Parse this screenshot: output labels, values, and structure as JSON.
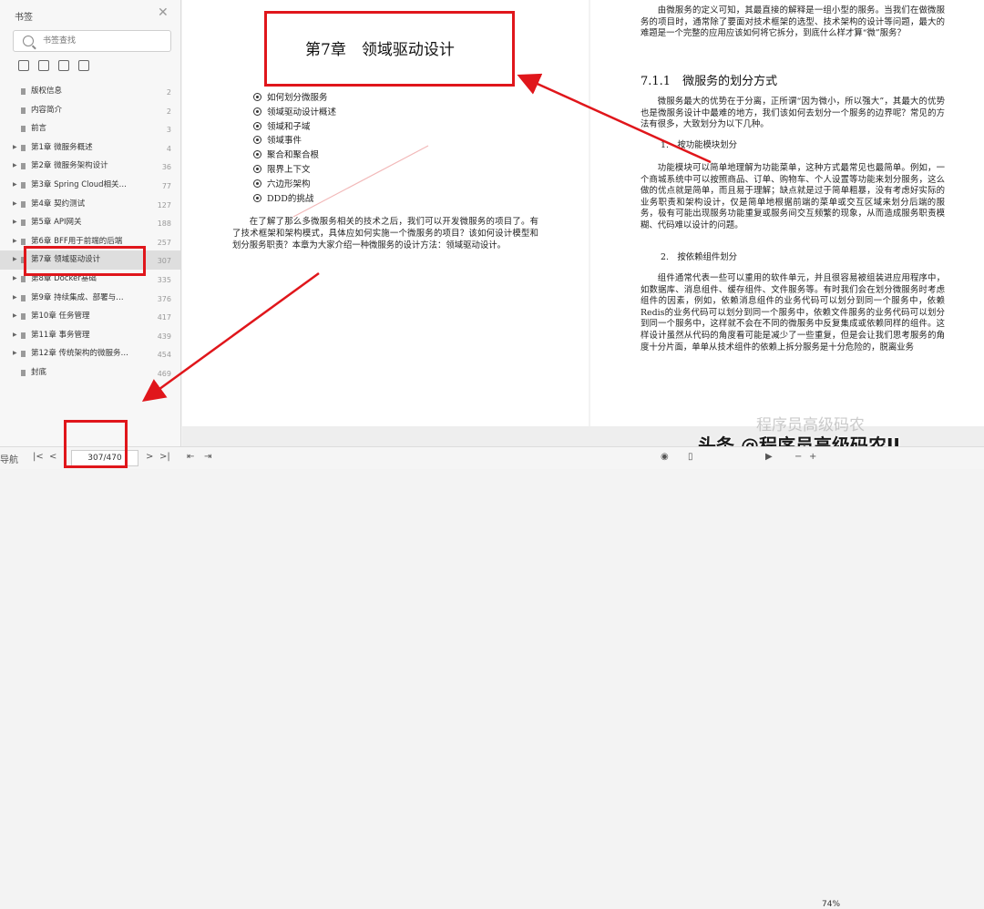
{
  "sidebar": {
    "title": "书签",
    "search_placeholder": "书签查找",
    "items": [
      {
        "label": "版权信息",
        "page": "2",
        "expandable": false
      },
      {
        "label": "内容简介",
        "page": "2",
        "expandable": false
      },
      {
        "label": "前言",
        "page": "3",
        "expandable": false
      },
      {
        "label": "第1章 微服务概述",
        "page": "4",
        "expandable": true
      },
      {
        "label": "第2章 微服务架构设计",
        "page": "36",
        "expandable": true
      },
      {
        "label": "第3章 Spring Cloud相关…",
        "page": "77",
        "expandable": true
      },
      {
        "label": "第4章 契约测试",
        "page": "127",
        "expandable": true
      },
      {
        "label": "第5章 API网关",
        "page": "188",
        "expandable": true
      },
      {
        "label": "第6章 BFF用于前端的后端",
        "page": "257",
        "expandable": true
      },
      {
        "label": "第7章 领域驱动设计",
        "page": "307",
        "expandable": true,
        "active": true
      },
      {
        "label": "第8章 Docker基础",
        "page": "335",
        "expandable": true
      },
      {
        "label": "第9章 持续集成、部署与…",
        "page": "376",
        "expandable": true
      },
      {
        "label": "第10章 任务管理",
        "page": "417",
        "expandable": true
      },
      {
        "label": "第11章 事务管理",
        "page": "439",
        "expandable": true
      },
      {
        "label": "第12章 传统架构的微服务…",
        "page": "454",
        "expandable": true
      },
      {
        "label": "封底",
        "page": "469",
        "expandable": false
      }
    ]
  },
  "bottom": {
    "nav_label": "导航",
    "page_indicator": "307/470",
    "zoom": "74%"
  },
  "left_page": {
    "chapter_title": "第7章　领域驱动设计",
    "bullets": [
      "如何划分微服务",
      "领域驱动设计概述",
      "领域和子域",
      "领域事件",
      "聚合和聚合根",
      "限界上下文",
      "六边形架构",
      "DDD的挑战"
    ],
    "intro": "在了解了那么多微服务相关的技术之后，我们可以开发微服务的项目了。有了技术框架和架构模式，具体应如何实施一个微服务的项目？该如何设计模型和划分服务职责？本章为大家介绍一种微服务的设计方法：领域驱动设计。"
  },
  "right_page": {
    "p1": "由微服务的定义可知，其最直接的解释是一组小型的服务。当我们在做微服务的项目时，通常除了要面对技术框架的选型、技术架构的设计等问题，最大的难题是一个完整的应用应该如何将它拆分，到底什么样才算“微”服务？",
    "heading": "7.1.1　微服务的划分方式",
    "p2": "微服务最大的优势在于分离，正所谓“因为微小，所以强大”，其最大的优势也是微服务设计中最难的地方，我们该如何去划分一个服务的边界呢？常见的方法有很多，大致划分为以下几种。",
    "sub1": "1.　按功能模块划分",
    "p3": "功能模块可以简单地理解为功能菜单，这种方式最常见也最简单。例如，一个商城系统中可以按照商品、订单、购物车、个人设置等功能来划分服务，这么做的优点就是简单，而且易于理解；缺点就是过于简单粗暴，没有考虑好实际的业务职责和架构设计，仅是简单地根据前端的菜单或交互区域来划分后端的服务，极有可能出现服务功能重复或服务间交互频繁的现象，从而造成服务职责模糊、代码难以设计的问题。",
    "sub2": "2.　按依赖组件划分",
    "p4": "组件通常代表一些可以重用的软件单元，并且很容易被组装进应用程序中，如数据库、消息组件、缓存组件、文件服务等。有时我们会在划分微服务时考虑组件的因素，例如，依赖消息组件的业务代码可以划分到同一个服务中，依赖Redis的业务代码可以划分到同一个服务中，依赖文件服务的业务代码可以划分到同一个服务中，这样就不会在不同的微服务中反复集成或依赖同样的组件。这样设计虽然从代码的角度看可能是减少了一些重复，但是会让我们思考服务的角度十分片面，单单从技术组件的依赖上拆分服务是十分危险的，脱离业务"
  },
  "watermarks": {
    "wm1": "程序员高级码农",
    "wm2": "头条 @程序员高级码农II"
  },
  "colors": {
    "annotation_red": "#e0161b"
  }
}
